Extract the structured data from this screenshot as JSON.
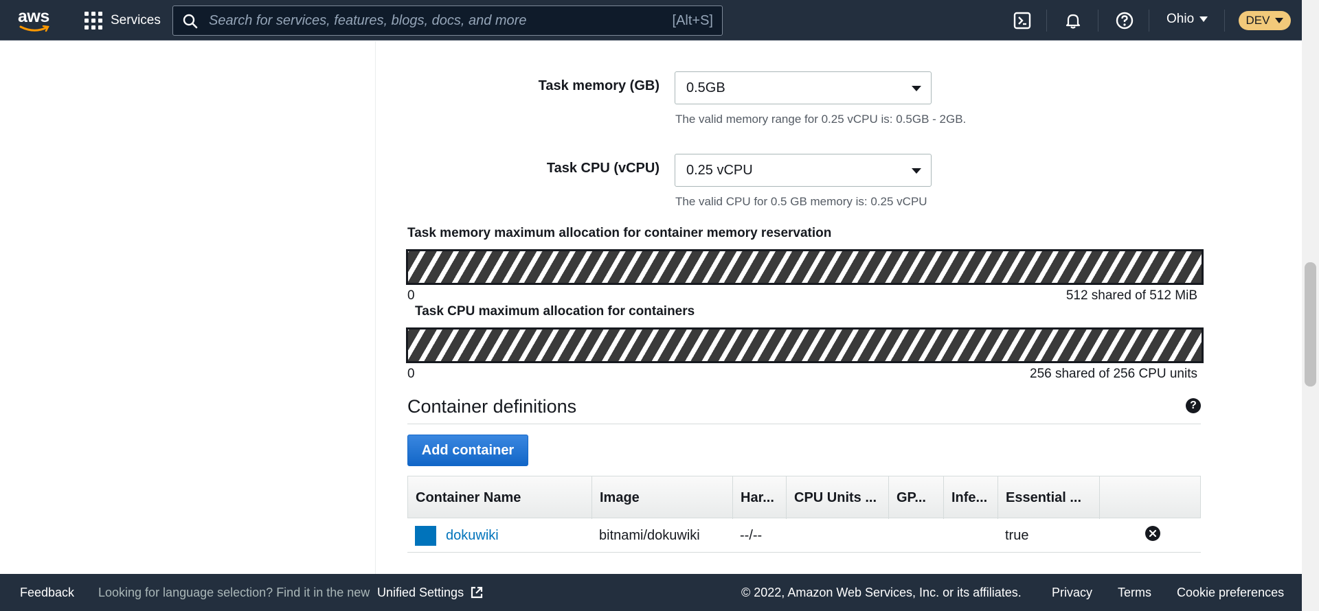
{
  "topnav": {
    "logo_text": "aws",
    "services_label": "Services",
    "search_placeholder": "Search for services, features, blogs, docs, and more",
    "search_shortcut": "[Alt+S]",
    "icons": [
      "cloudshell-icon",
      "bell-icon",
      "help-icon"
    ],
    "region": "Ohio",
    "account": "DEV"
  },
  "task_size": {
    "memory": {
      "label": "Task memory (GB)",
      "value": "0.5GB",
      "hint": "The valid memory range for 0.25 vCPU is: 0.5GB - 2GB."
    },
    "cpu": {
      "label": "Task CPU (vCPU)",
      "value": "0.25 vCPU",
      "hint": "The valid CPU for 0.5 GB memory is: 0.25 vCPU"
    }
  },
  "allocation": {
    "memory": {
      "title": "Task memory maximum allocation for container memory reservation",
      "min": "0",
      "summary": "512 shared of 512 MiB",
      "used": 512,
      "total": 512
    },
    "cpu": {
      "title": "Task CPU maximum allocation for containers",
      "min": "0",
      "summary": "256 shared of 256 CPU units",
      "used": 256,
      "total": 256
    }
  },
  "containers": {
    "title": "Container definitions",
    "help": "?",
    "add_label": "Add container",
    "columns": [
      "Container Name",
      "Image",
      "Har...",
      "CPU Units ...",
      "GP...",
      "Infe...",
      "Essential ...",
      ""
    ],
    "rows": [
      {
        "name": "dokuwiki",
        "image": "bitnami/dokuwiki",
        "hard_soft": "--/--",
        "cpu": "",
        "gpu": "",
        "inference": "",
        "essential": "true",
        "color": "#0073bb"
      }
    ]
  },
  "footer": {
    "feedback": "Feedback",
    "language_note": "Looking for language selection? Find it in the new",
    "unified_settings": "Unified Settings",
    "copyright": "© 2022, Amazon Web Services, Inc. or its affiliates.",
    "privacy": "Privacy",
    "terms": "Terms",
    "cookies": "Cookie preferences"
  }
}
